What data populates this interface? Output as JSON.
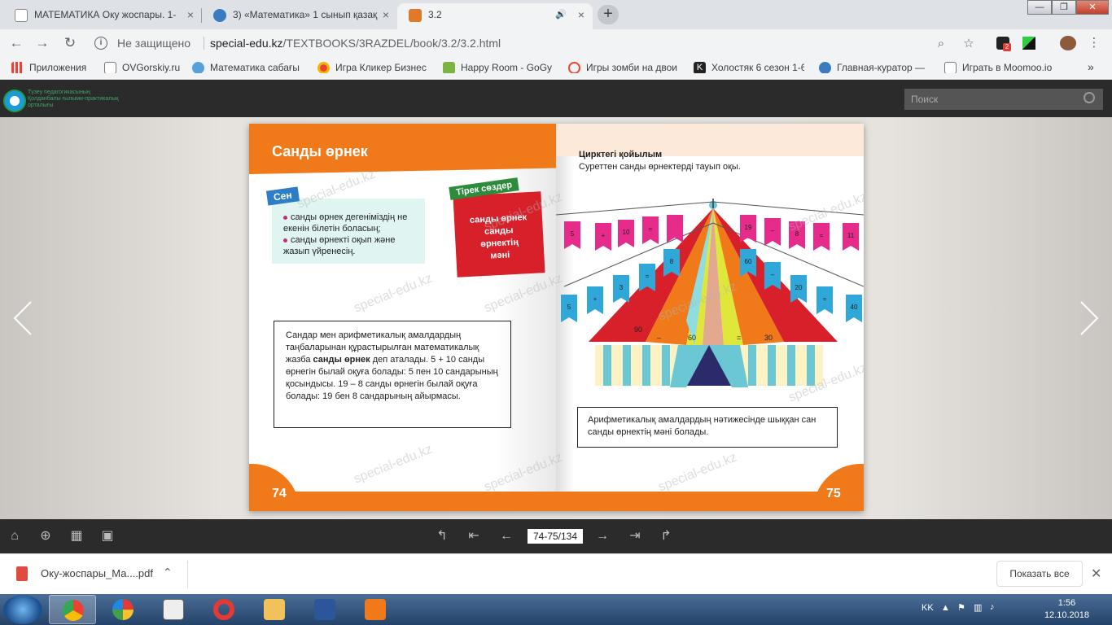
{
  "tabs": [
    {
      "title": "МАТЕМАТИКА Оку жоспары. 1-",
      "close": "×",
      "icon_color": "#ffffff"
    },
    {
      "title": "3) «Математика» 1 сынып қазақ",
      "close": "×",
      "icon_color": "#3b7bbf"
    },
    {
      "title": "3.2",
      "close": "×",
      "icon_color": "#e07a2a",
      "active": true,
      "audio_icon": "🔊"
    }
  ],
  "new_tab": "+",
  "window_controls": {
    "minimize": "—",
    "maximize": "❐",
    "close": "✕"
  },
  "omnibox": {
    "security_label": "Не защищено",
    "url_host": "special-edu.kz",
    "url_path": "/TEXTBOOKS/3RAZDEL/book/3.2/3.2.html"
  },
  "toolbar_icons": [
    "back-icon",
    "forward-icon",
    "reload-icon",
    "zoom-icon",
    "star-icon",
    "extension-icon",
    "profile-icon",
    "menu-icon"
  ],
  "extension_badge": "2",
  "bookmarks": [
    {
      "label": "Приложения",
      "color": "#ea4335"
    },
    {
      "label": "OVGorskiy.ru",
      "color": "#ffffff"
    },
    {
      "label": "Математика сабағы",
      "color": "#5aa0d8"
    },
    {
      "label": "Игра Кликер Бизнес",
      "color": "#f4b400"
    },
    {
      "label": "Happy Room - GoGy",
      "color": "#7cb342"
    },
    {
      "label": "Игры зомби на двои",
      "color": "#ea4335"
    },
    {
      "label": "Холостяк 6 сезон 1-6",
      "color": "#222222"
    },
    {
      "label": "Главная-куратор —",
      "color": "#3b7bbf"
    },
    {
      "label": "Играть в Moomoo.io",
      "color": "#ffffff"
    }
  ],
  "bookmarks_more": "»",
  "site": {
    "logo_text": [
      "Түзеу педагогикасының",
      "Қолданбалы ғылыми-практикалық",
      "орталығы"
    ],
    "search_placeholder": "Поиск"
  },
  "left_page": {
    "title": "Санды өрнек",
    "you_tag": "Сен",
    "goals": [
      "санды өрнек дегеніміздің не екенін білетін боласың;",
      "санды өрнекті оқып және жазып үйренесің."
    ],
    "key_tag": "Тірек сөздер",
    "key_words": [
      "санды өрнек",
      "санды",
      "өрнектің",
      "мәні"
    ],
    "definition_before": "Сандар мен арифметикалық амалдардың таңбаларынан құрастырылған математикалық жазба ",
    "definition_bold": "санды өрнек",
    "definition_after": " деп аталады. 5 + 10 санды өрнегін былай оқуға болады: 5 пен 10 сандарының қосындысы. 19 – 8 санды өрнегін былай оқуға болады: 19 бен 8 сандарының айырмасы.",
    "page_number": "74"
  },
  "right_page": {
    "title": "Цирктегі қойылым",
    "subtitle": "Суреттен санды өрнектерді тауып оқы.",
    "top_flags": [
      "5",
      "+",
      "10",
      "=",
      "",
      "19",
      "–",
      "8",
      "=",
      "11"
    ],
    "middle_flags": [
      "5",
      "+",
      "3",
      "=",
      "8",
      "60",
      "–",
      "20",
      "=",
      "40"
    ],
    "tent_labels": [
      "90",
      "–",
      "60",
      "=",
      "30"
    ],
    "result_text": "Арифметикалық амалдардың нәтижесінде шыққан сан санды өрнектің мәні болады.",
    "page_number": "75"
  },
  "watermark": "special-edu.kz",
  "reader_toolbar": {
    "page_counter": "74-75/134"
  },
  "download": {
    "file": "Оку-жоспары_Ма....pdf",
    "show_all": "Показать все"
  },
  "tray": {
    "lang": "KK",
    "time": "1:56",
    "date": "12.10.2018"
  }
}
